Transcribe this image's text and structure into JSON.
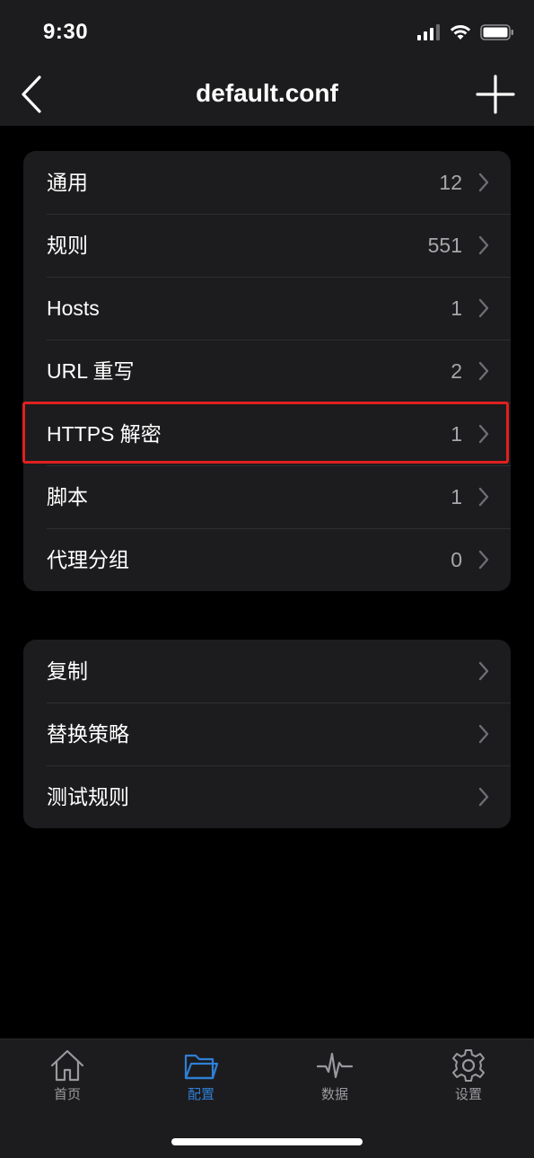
{
  "status_bar": {
    "time": "9:30"
  },
  "nav": {
    "title": "default.conf",
    "back_icon": "chevron-left-icon",
    "add_icon": "plus-icon"
  },
  "groups": [
    {
      "rows": [
        {
          "label": "通用",
          "count": "12"
        },
        {
          "label": "规则",
          "count": "551"
        },
        {
          "label": "Hosts",
          "count": "1"
        },
        {
          "label": "URL 重写",
          "count": "2"
        },
        {
          "label": "HTTPS 解密",
          "count": "1"
        },
        {
          "label": "脚本",
          "count": "1"
        },
        {
          "label": "代理分组",
          "count": "0"
        }
      ]
    },
    {
      "rows": [
        {
          "label": "复制"
        },
        {
          "label": "替换策略"
        },
        {
          "label": "测试规则"
        }
      ]
    }
  ],
  "highlight": {
    "color": "#e02020",
    "target": "HTTPS 解密"
  },
  "tab_bar": {
    "tabs": [
      {
        "label": "首页",
        "icon": "home-icon",
        "active": false
      },
      {
        "label": "配置",
        "icon": "folder-icon",
        "active": true
      },
      {
        "label": "数据",
        "icon": "activity-icon",
        "active": false
      },
      {
        "label": "设置",
        "icon": "gear-icon",
        "active": false
      }
    ]
  },
  "colors": {
    "accent": "#2f7fd6",
    "background": "#000000",
    "cell": "#1c1c1e",
    "secondary_text": "#a7a7ab"
  }
}
